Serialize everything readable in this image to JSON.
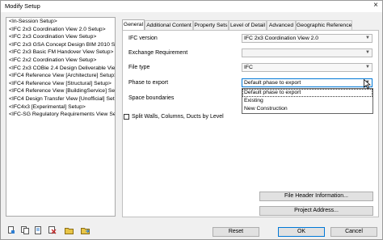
{
  "window": {
    "title": "Modify Setup"
  },
  "setups": [
    "<In-Session Setup>",
    "<IFC 2x3 Coordination View 2.0 Setup>",
    "<IFC 2x3 Coordination View Setup>",
    "<IFC 2x3 GSA Concept Design BIM 2010 Setu",
    "<IFC 2x3 Basic FM Handover View Setup>",
    "<IFC 2x2 Coordination View Setup>",
    "<IFC 2x3 COBie 2.4 Design Deliverable View Se",
    "<IFC4 Reference View [Architecture] Setup>",
    "<IFC4 Reference View [Structural] Setup>",
    "<IFC4 Reference View [BuildingService] Setup>",
    "<IFC4 Design Transfer View [Unofficial] Setup>",
    "<IFC4x3 [Experimental] Setup>",
    "<IFC-SG Regulatory Requirements View Setup>"
  ],
  "tabs": [
    "General",
    "Additional Content",
    "Property Sets",
    "Level of Detail",
    "Advanced",
    "Geographic Reference"
  ],
  "fields": {
    "ifc_version_label": "IFC version",
    "ifc_version_value": "IFC 2x3 Coordination View 2.0",
    "exchange_label": "Exchange Requirement",
    "exchange_value": "",
    "file_type_label": "File type",
    "file_type_value": "IFC",
    "phase_label": "Phase to export",
    "phase_value": "Default phase to export",
    "space_label": "Space boundaries",
    "split_label": "Split Walls, Columns, Ducts by Level"
  },
  "phase_options": [
    "Default phase to export",
    "Existing",
    "New Construction"
  ],
  "buttons": {
    "file_header": "File Header Information...",
    "project_address": "Project Address...",
    "reset": "Reset",
    "ok": "OK",
    "cancel": "Cancel"
  },
  "icons": [
    "new-setup-icon",
    "duplicate-setup-icon",
    "rename-setup-icon",
    "delete-setup-icon",
    "import-setup-icon",
    "export-setup-icon"
  ]
}
